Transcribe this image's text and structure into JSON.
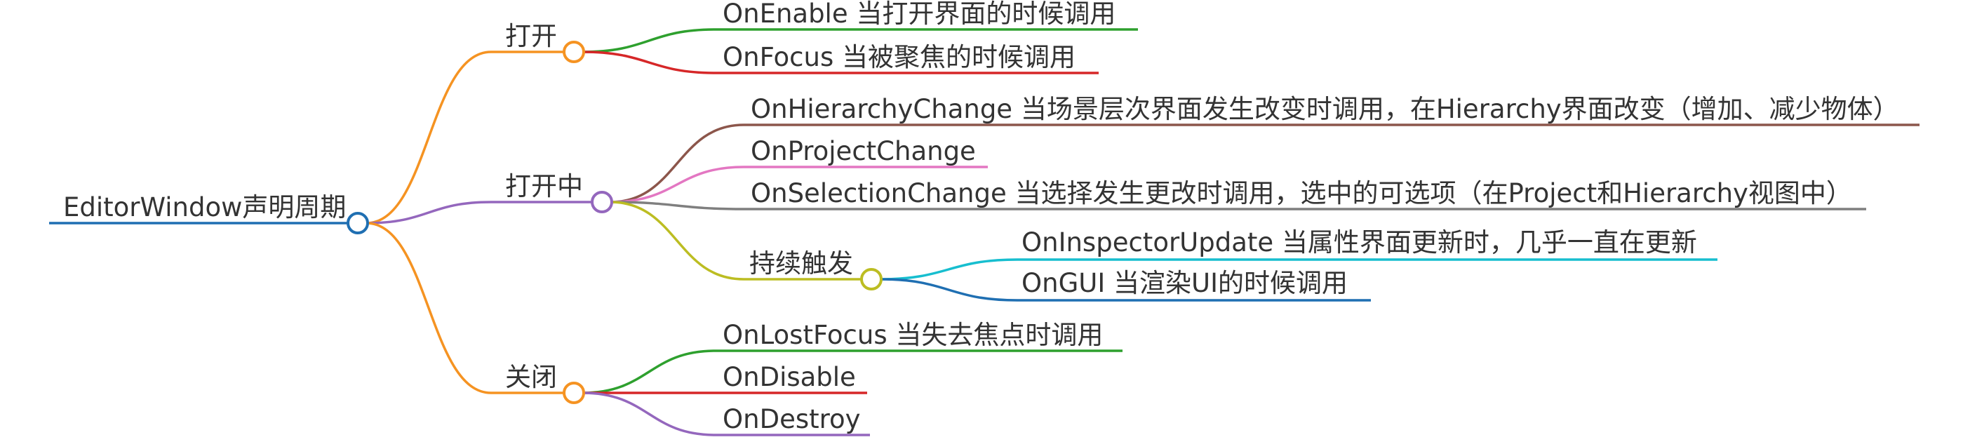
{
  "root": {
    "label": "EditorWindow声明周期",
    "color": "#1f6fb2"
  },
  "branches": [
    {
      "label": "打开",
      "color": "#f59322",
      "children": [
        {
          "label": "OnEnable 当打开界面的时候调用",
          "color": "#2ea02e"
        },
        {
          "label": "OnFocus 当被聚焦的时候调用",
          "color": "#d62728"
        }
      ]
    },
    {
      "label": "打开中",
      "color": "#9467bd",
      "children": [
        {
          "label": "OnHierarchyChange 当场景层次界面发生改变时调用，在Hierarchy界面改变（增加、减少物体）",
          "color": "#8c564b"
        },
        {
          "label": "OnProjectChange",
          "color": "#e377c2"
        },
        {
          "label": "OnSelectionChange 当选择发生更改时调用，选中的可选项（在Project和Hierarchy视图中）",
          "color": "#7f7f7f"
        },
        {
          "label": "持续触发",
          "color": "#bcbd22",
          "children": [
            {
              "label": "OnInspectorUpdate 当属性界面更新时，几乎一直在更新",
              "color": "#17becf"
            },
            {
              "label": "OnGUI 当渲染UI的时候调用",
              "color": "#1f6fb2"
            }
          ]
        }
      ]
    },
    {
      "label": "关闭",
      "color": "#f59322",
      "children": [
        {
          "label": "OnLostFocus 当失去焦点时调用",
          "color": "#2ea02e"
        },
        {
          "label": "OnDisable",
          "color": "#d62728"
        },
        {
          "label": "OnDestroy",
          "color": "#9467bd"
        }
      ]
    }
  ]
}
